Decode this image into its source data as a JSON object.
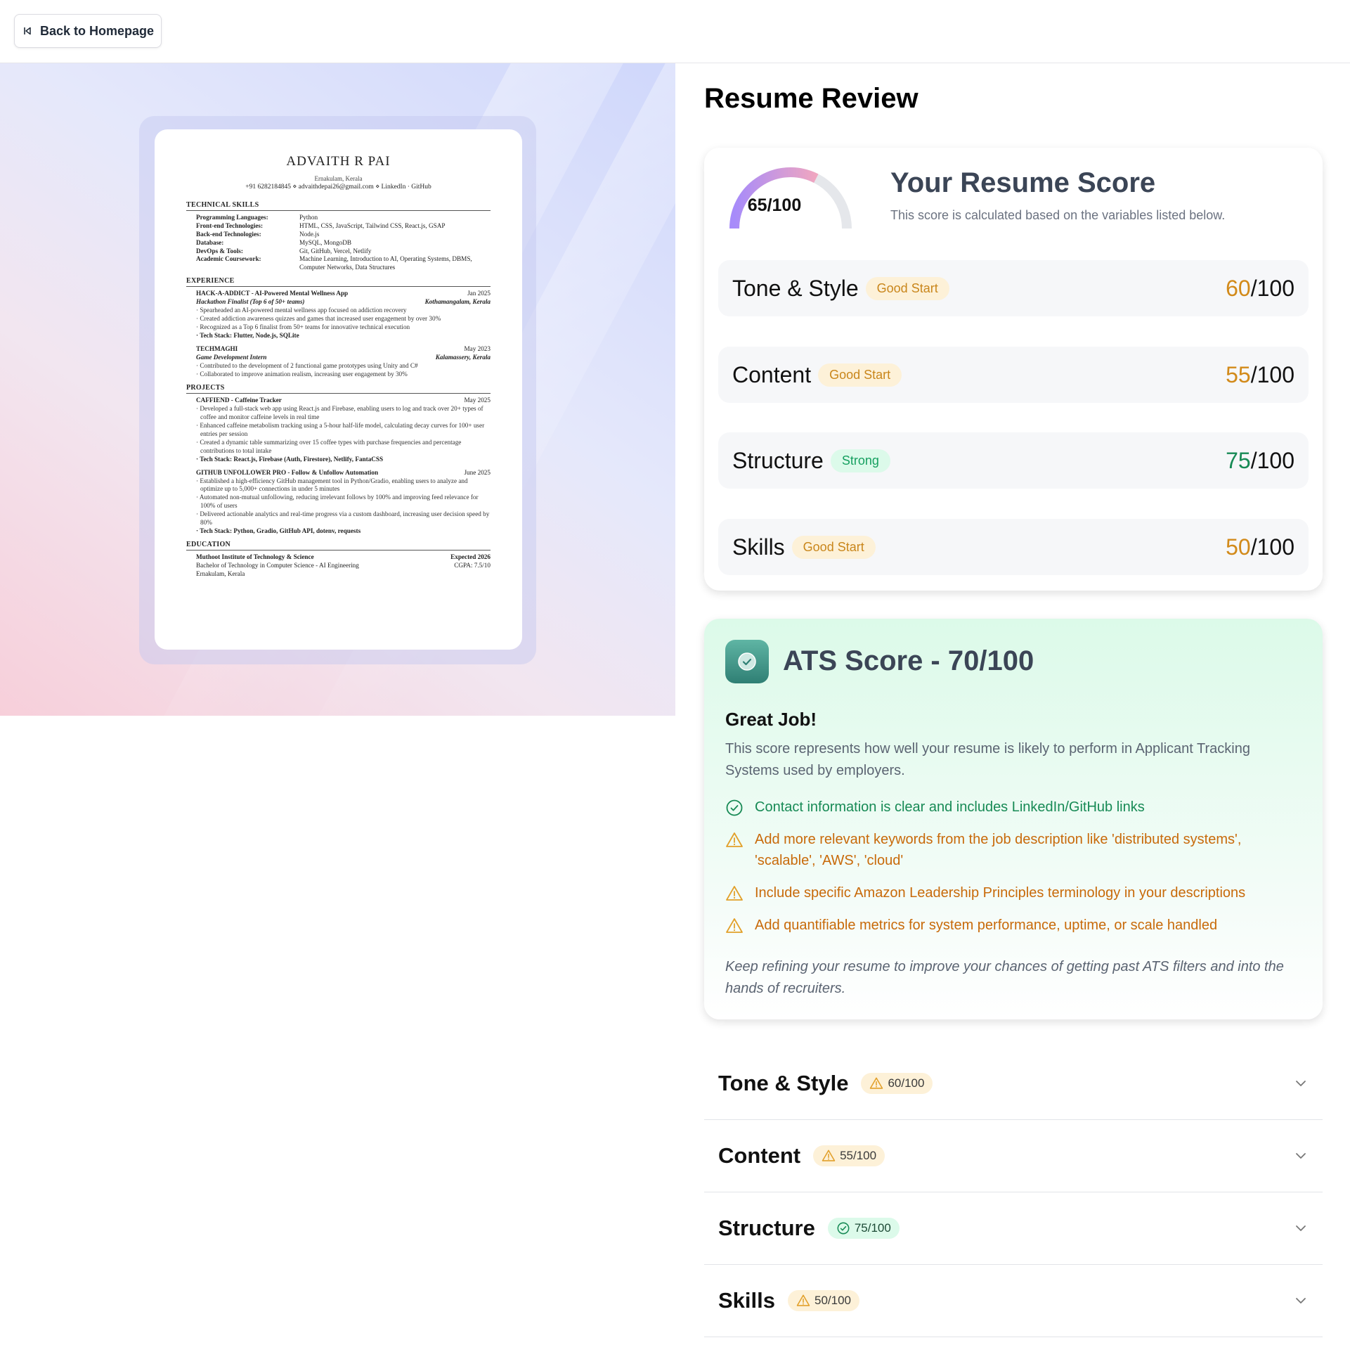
{
  "nav": {
    "back_label": "Back to Homepage"
  },
  "resume": {
    "name": "ADVAITH R PAI",
    "location": "Ernakulam, Kerala",
    "contact": "+91 6282184845 ⋄ advaithdepai26@gmail.com ⋄ LinkedIn · GitHub",
    "skills_heading": "TECHNICAL SKILLS",
    "skills": [
      {
        "k": "Programming Languages:",
        "v": "Python"
      },
      {
        "k": "Front-end Technologies:",
        "v": "HTML, CSS, JavaScript, Tailwind CSS, React.js, GSAP"
      },
      {
        "k": "Back-end Technologies:",
        "v": "Node.js"
      },
      {
        "k": "Database:",
        "v": "MySQL, MongoDB"
      },
      {
        "k": "DevOps & Tools:",
        "v": "Git, GitHub, Vercel, Netlify"
      },
      {
        "k": "Academic Coursework:",
        "v": "Machine Learning, Introduction to AI, Operating Systems, DBMS, Computer Networks, Data Structures"
      }
    ],
    "experience_heading": "EXPERIENCE",
    "exp1_title": "HACK-A-ADDICT - AI-Powered Mental Wellness App",
    "exp1_date": "Jan 2025",
    "exp1_role": "Hackathon Finalist (Top 6 of 50+ teams)",
    "exp1_place": "Kothamangalam, Kerala",
    "exp1_b1": "· Spearheaded an AI-powered mental wellness app focused on addiction recovery",
    "exp1_b2": "· Created addiction awareness quizzes and games that increased user engagement by over 30%",
    "exp1_b3": "· Recognized as a Top 6 finalist from 50+ teams for innovative technical execution",
    "exp1_b4": "· Tech Stack: Flutter, Node.js, SQLite",
    "exp2_title": "TECHMAGHI",
    "exp2_date": "May 2023",
    "exp2_role": "Game Development Intern",
    "exp2_place": "Kalamassery, Kerala",
    "exp2_b1": "· Contributed to the development of 2 functional game prototypes using Unity and C#",
    "exp2_b2": "· Collaborated to improve animation realism, increasing user engagement by 30%",
    "projects_heading": "PROJECTS",
    "p1_title": "CAFFIEND - Caffeine Tracker",
    "p1_date": "May 2025",
    "p1_b1": "· Developed a full-stack web app using React.js and Firebase, enabling users to log and track over 20+ types of coffee and monitor caffeine levels in real time",
    "p1_b2": "· Enhanced caffeine metabolism tracking using a 5-hour half-life model, calculating decay curves for 100+ user entries per session",
    "p1_b3": "· Created a dynamic table summarizing over 15 coffee types with purchase frequencies and percentage contributions to total intake",
    "p1_b4": "· Tech Stack: React.js, Firebase (Auth, Firestore), Netlify, FantaCSS",
    "p2_title": "GITHUB UNFOLLOWER PRO - Follow & Unfollow Automation",
    "p2_date": "June 2025",
    "p2_b1": "· Established a high-efficiency GitHub management tool in Python/Gradio, enabling users to analyze and optimize up to 5,000+ connections in under 5 minutes",
    "p2_b2": "· Automated non-mutual unfollowing, reducing irrelevant follows by 100% and improving feed relevance for 100% of users",
    "p2_b3": "· Delivered actionable analytics and real-time progress via a custom dashboard, increasing user decision speed by 80%",
    "p2_b4": "· Tech Stack: Python, Gradio, GitHub API, dotenv, requests",
    "education_heading": "EDUCATION",
    "edu_school": "Muthoot Institute of Technology & Science",
    "edu_date": "Expected 2026",
    "edu_degree": "Bachelor of Technology in Computer Science - AI Engineering",
    "edu_cgpa": "CGPA: 7.5/10",
    "edu_place": "Ernakulam, Kerala"
  },
  "review": {
    "title": "Resume Review",
    "overall": {
      "value": "65/100",
      "fraction": 0.65,
      "title": "Your Resume Score",
      "desc": "This score is calculated based on the variables listed below."
    },
    "categories": [
      {
        "name": "Tone & Style",
        "badge": "Good Start",
        "score": "60",
        "total": "/100",
        "status": "warn"
      },
      {
        "name": "Content",
        "badge": "Good Start",
        "score": "55",
        "total": "/100",
        "status": "warn"
      },
      {
        "name": "Structure",
        "badge": "Strong",
        "score": "75",
        "total": "/100",
        "status": "good"
      },
      {
        "name": "Skills",
        "badge": "Good Start",
        "score": "50",
        "total": "/100",
        "status": "warn"
      }
    ],
    "ats": {
      "title": "ATS Score - 70/100",
      "subtitle": "Great Job!",
      "desc": "This score represents how well your resume is likely to perform in Applicant Tracking Systems used by employers.",
      "tips": [
        {
          "text": "Contact information is clear and includes LinkedIn/GitHub links",
          "type": "good"
        },
        {
          "text": "Add more relevant keywords from the job description like 'distributed systems', 'scalable', 'AWS', 'cloud'",
          "type": "warn"
        },
        {
          "text": "Include specific Amazon Leadership Principles terminology in your descriptions",
          "type": "warn"
        },
        {
          "text": "Add quantifiable metrics for system performance, uptime, or scale handled",
          "type": "warn"
        }
      ],
      "footer": "Keep refining your resume to improve your chances of getting past ATS filters and into the hands of recruiters."
    },
    "accordion": [
      {
        "title": "Tone & Style",
        "score": "60/100",
        "type": "warn"
      },
      {
        "title": "Content",
        "score": "55/100",
        "type": "warn"
      },
      {
        "title": "Structure",
        "score": "75/100",
        "type": "good"
      },
      {
        "title": "Skills",
        "score": "50/100",
        "type": "warn"
      }
    ]
  },
  "colors": {
    "warn": "#d28a1a",
    "good": "#178a55",
    "gauge_start": "#a78bfa",
    "gauge_end": "#f0a6c0",
    "gauge_track": "#e5e7eb"
  },
  "icons": {
    "back": "skip-back-icon",
    "ats": "check-badge-icon",
    "good": "check-circle-icon",
    "warn": "warning-triangle-icon",
    "chevron": "chevron-down-icon"
  }
}
